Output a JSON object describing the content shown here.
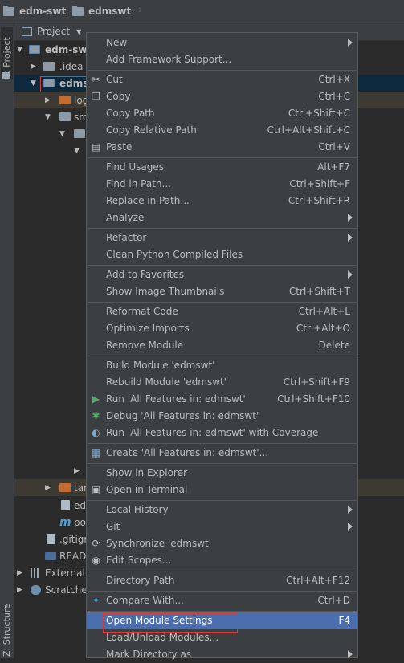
{
  "breadcrumbs": [
    "edm-swt",
    "edmswt"
  ],
  "tool_window_tabs": {
    "project": "1: Project",
    "structure": "Z: Structure"
  },
  "panel": {
    "view_mode": "Project"
  },
  "tree": [
    {
      "label": "edm-swt",
      "bold": true
    },
    {
      "label": ".idea"
    },
    {
      "label": "edms",
      "bold": true,
      "selected": true
    },
    {
      "label": "log"
    },
    {
      "label": "src"
    },
    {
      "label": ""
    },
    {
      "label": ""
    },
    {
      "label": "tar"
    },
    {
      "label": "ed"
    },
    {
      "label": "po"
    },
    {
      "label": ".gitigr"
    },
    {
      "label": "READ"
    },
    {
      "label": "External"
    },
    {
      "label": "Scratches"
    }
  ],
  "menu": {
    "new": "New",
    "add_framework": "Add Framework Support...",
    "cut": "Cut",
    "cut_sc": "Ctrl+X",
    "copy": "Copy",
    "copy_sc": "Ctrl+C",
    "copy_path": "Copy Path",
    "copy_path_sc": "Ctrl+Shift+C",
    "copy_rel": "Copy Relative Path",
    "copy_rel_sc": "Ctrl+Alt+Shift+C",
    "paste": "Paste",
    "paste_sc": "Ctrl+V",
    "find_usages": "Find Usages",
    "find_usages_sc": "Alt+F7",
    "find_in_path": "Find in Path...",
    "find_in_path_sc": "Ctrl+Shift+F",
    "replace_in_path": "Replace in Path...",
    "replace_in_path_sc": "Ctrl+Shift+R",
    "analyze": "Analyze",
    "refactor": "Refactor",
    "clean_python": "Clean Python Compiled Files",
    "add_favorites": "Add to Favorites",
    "show_thumbnails": "Show Image Thumbnails",
    "show_thumbnails_sc": "Ctrl+Shift+T",
    "reformat": "Reformat Code",
    "reformat_sc": "Ctrl+Alt+L",
    "optimize": "Optimize Imports",
    "optimize_sc": "Ctrl+Alt+O",
    "remove_module": "Remove Module",
    "remove_module_sc": "Delete",
    "build_module": "Build Module 'edmswt'",
    "rebuild_module": "Rebuild Module 'edmswt'",
    "rebuild_module_sc": "Ctrl+Shift+F9",
    "run": "Run 'All Features in: edmswt'",
    "run_sc": "Ctrl+Shift+F10",
    "debug": "Debug 'All Features in: edmswt'",
    "run_coverage": "Run 'All Features in: edmswt' with Coverage",
    "create": "Create 'All Features in: edmswt'...",
    "show_explorer": "Show in Explorer",
    "open_terminal": "Open in Terminal",
    "local_history": "Local History",
    "git": "Git",
    "synchronize": "Synchronize 'edmswt'",
    "edit_scopes": "Edit Scopes...",
    "dir_path": "Directory Path",
    "dir_path_sc": "Ctrl+Alt+F12",
    "compare": "Compare With...",
    "compare_sc": "Ctrl+D",
    "module_settings": "Open Module Settings",
    "module_settings_sc": "F4",
    "load_unload": "Load/Unload Modules...",
    "mark_directory": "Mark Directory as"
  },
  "colors": {
    "menu_bg": "#3c3f41",
    "selection": "#4b6eaf",
    "run_green": "#59a869",
    "annotation_red": "#e03b3b"
  }
}
